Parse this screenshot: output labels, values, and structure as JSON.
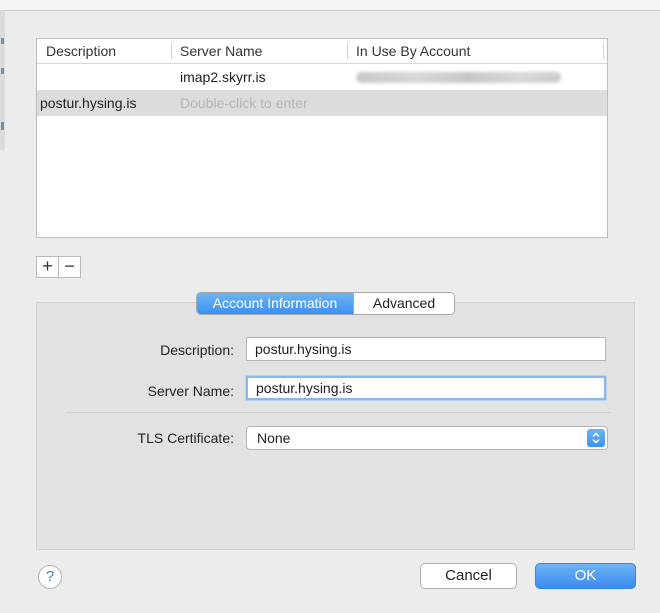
{
  "table": {
    "headers": [
      "Description",
      "Server Name",
      "In Use By Account"
    ],
    "rows": [
      {
        "description": "",
        "server_name": "imap2.skyrr.is",
        "account": ""
      },
      {
        "description": "postur.hysing.is",
        "server_name": "Double-click to enter",
        "account": ""
      }
    ]
  },
  "controls": {
    "add_label": "+",
    "remove_label": "−"
  },
  "tabs": {
    "active": "Account Information",
    "inactive": "Advanced"
  },
  "form": {
    "description_label": "Description:",
    "description_value": "postur.hysing.is",
    "server_name_label": "Server Name:",
    "server_name_value": "postur.hysing.is",
    "tls_label": "TLS Certificate:",
    "tls_value": "None"
  },
  "buttons": {
    "help": "?",
    "cancel": "Cancel",
    "ok": "OK"
  },
  "colors": {
    "accent": "#4a98f1",
    "selected_row": "#dcdcdc"
  }
}
